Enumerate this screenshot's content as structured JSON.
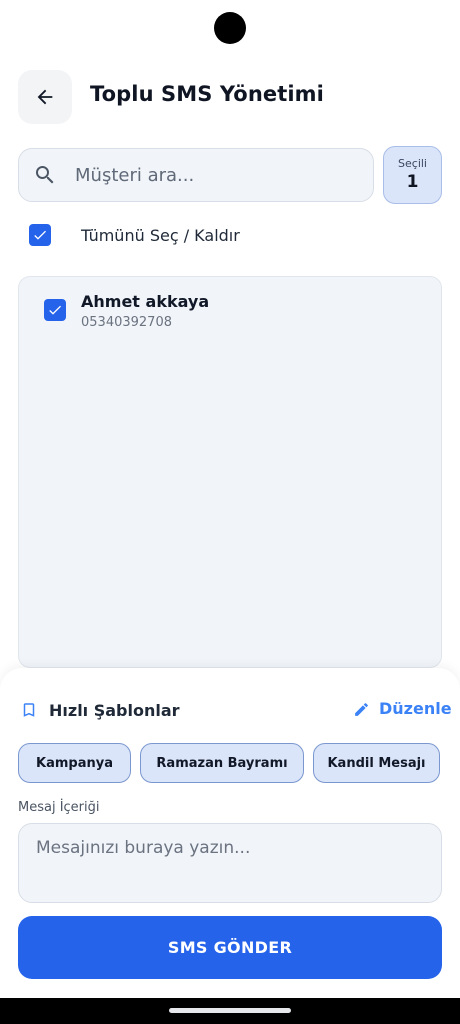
{
  "header": {
    "title": "Toplu SMS Yönetimi",
    "back_icon": "arrow-left-icon"
  },
  "search": {
    "placeholder": "Müşteri ara...",
    "value": "",
    "icon": "search-icon"
  },
  "selected": {
    "label": "Seçili",
    "count": "1"
  },
  "select_all": {
    "label": "Tümünü Seç / Kaldır",
    "checked": true
  },
  "customers": [
    {
      "name": "Ahmet akkaya",
      "phone": "05340392708",
      "checked": true
    }
  ],
  "templates": {
    "title": "Hızlı Şablonlar",
    "edit_label": "Düzenle",
    "chips": [
      {
        "label": "Kampanya"
      },
      {
        "label": "Ramazan Bayramı"
      },
      {
        "label": "Kandil Mesajı"
      }
    ]
  },
  "message": {
    "label": "Mesaj İçeriği",
    "placeholder": "Mesajınızı buraya yazın...",
    "value": ""
  },
  "send_button": {
    "label": "SMS GÖNDER"
  },
  "colors": {
    "primary": "#2563eb",
    "accent_text": "#3b82f6",
    "chip_bg": "#dbe5f9",
    "surface": "#f1f5f9"
  }
}
